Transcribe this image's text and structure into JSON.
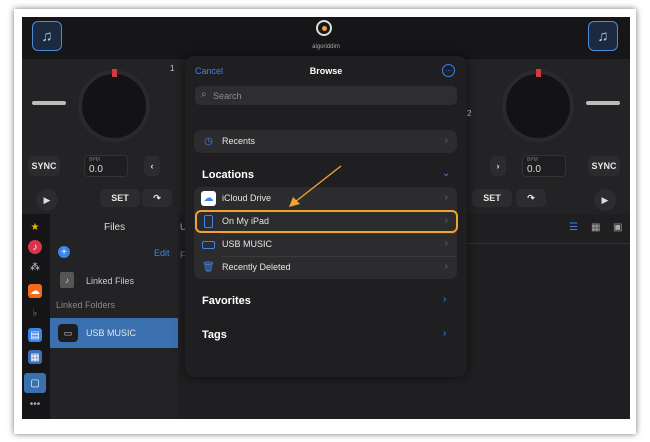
{
  "app": {
    "logo_text": "algoriddim",
    "left_deck": {
      "sync_label": "SYNC",
      "bpm_label": "BPM",
      "bpm_value": "0.0",
      "set_label": "SET",
      "pitch_marker": "1"
    },
    "right_deck": {
      "sync_label": "SYNC",
      "bpm_label": "BPM",
      "bpm_value": "0.0",
      "set_label": "SET",
      "pitch_marker": "2"
    }
  },
  "library": {
    "files_header": "Files",
    "edit_label": "Edit",
    "linked_files_label": "Linked Files",
    "linked_folders_header": "Linked Folders",
    "selected_folder": "USB MUSIC",
    "cut_label_1": "U",
    "cut_label_2": "F"
  },
  "browse_sheet": {
    "cancel_label": "Cancel",
    "title": "Browse",
    "search_placeholder": "Search",
    "recents_label": "Recents",
    "locations_header": "Locations",
    "locations": [
      {
        "label": "iCloud Drive",
        "icon": "cloud-icon"
      },
      {
        "label": "On My iPad",
        "icon": "ipad-icon",
        "highlighted": true
      },
      {
        "label": "USB MUSIC",
        "icon": "drive-icon"
      },
      {
        "label": "Recently Deleted",
        "icon": "trash-icon"
      }
    ],
    "favorites_header": "Favorites",
    "tags_header": "Tags"
  },
  "colors": {
    "accent_blue": "#3d84e8",
    "highlight_orange": "#f0a330",
    "selected_row": "#3a6fb0"
  }
}
